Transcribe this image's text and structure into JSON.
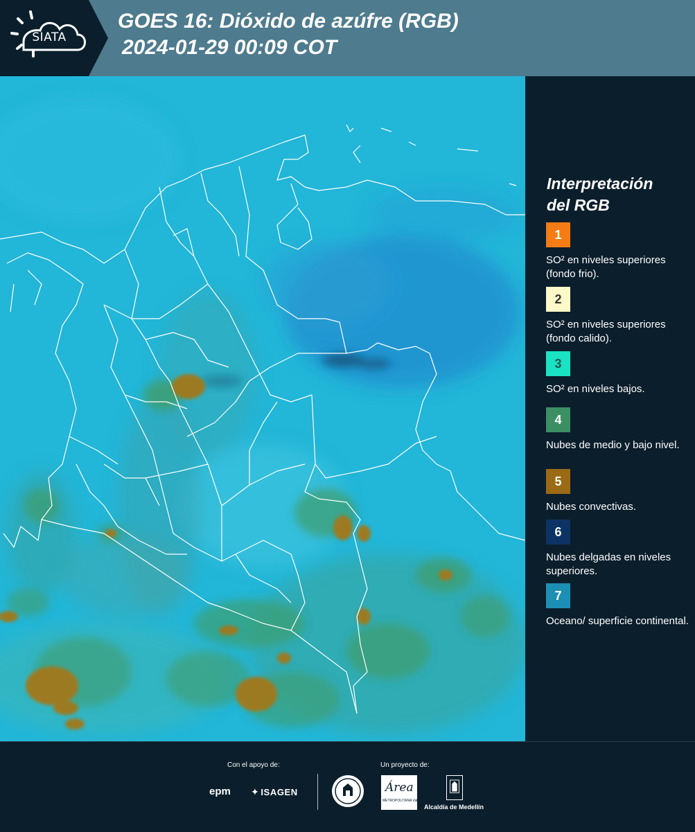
{
  "header": {
    "logo_text": "SIATA",
    "title_line1": "GOES 16: Dióxido de azúfre (RGB)",
    "title_line2": "2024-01-29 00:09 COT"
  },
  "colors": {
    "header_bg": "#4e7b8d",
    "logo_bg": "#0b1e2c",
    "panel_bg": "#0b1e2c",
    "map_background": "#22b6d8",
    "convective_cloud": "#9c7a23",
    "mid_low_cloud": "#3f9d6c",
    "border_lines": "#ffffff"
  },
  "legend": {
    "title_line1": "Interpretación",
    "title_line2": "del RGB",
    "items": [
      {
        "num": "1",
        "color": "#f47c14",
        "num_color": "#ffffff",
        "text": "SO² en niveles superiores (fondo frio)."
      },
      {
        "num": "2",
        "color": "#fff8c9",
        "num_color": "#333333",
        "text": "SO² en niveles superiores (fondo calido)."
      },
      {
        "num": "3",
        "color": "#19e3c2",
        "num_color": "#1c5a52",
        "text": "SO² en niveles bajos."
      },
      {
        "num": "4",
        "color": "#3b8f63",
        "num_color": "#ffffff",
        "text": "Nubes de medio y bajo nivel."
      },
      {
        "num": "5",
        "color": "#9b6a14",
        "num_color": "#ffffff",
        "text": "Nubes convectivas."
      },
      {
        "num": "6",
        "color": "#0c3364",
        "num_color": "#ffffff",
        "text": "Nubes delgadas en niveles superiores."
      },
      {
        "num": "7",
        "color": "#1d8fb4",
        "num_color": "#ffffff",
        "text": "Oceano/ superficie continental."
      }
    ]
  },
  "footer": {
    "support_label": "Con el apoyo de:",
    "project_label": "Un proyecto de:",
    "epm": "epm",
    "isagen": "ISAGEN",
    "area_logo": "Área",
    "area_sub": "METROPOLITANA Valle de Aburrá",
    "alcaldia": "Alcaldía de Medellín"
  }
}
